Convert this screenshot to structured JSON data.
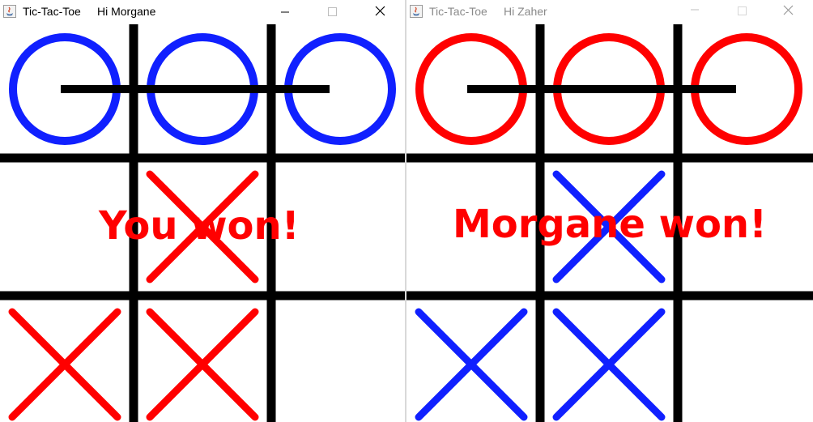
{
  "colors": {
    "grid": "#000000",
    "red": "#ff0000",
    "blue": "#1020ff"
  },
  "windows": [
    {
      "id": "left",
      "title_app": "Tic-Tac-Toe",
      "title_greeting": "Hi Morgane",
      "active": true,
      "message": "You won!",
      "cells": [
        {
          "mark": "O",
          "color": "blue"
        },
        {
          "mark": "O",
          "color": "blue"
        },
        {
          "mark": "O",
          "color": "blue"
        },
        null,
        {
          "mark": "X",
          "color": "red"
        },
        null,
        {
          "mark": "X",
          "color": "red"
        },
        {
          "mark": "X",
          "color": "red"
        },
        null
      ],
      "win_line": [
        0,
        2
      ]
    },
    {
      "id": "right",
      "title_app": "Tic-Tac-Toe",
      "title_greeting": "Hi Zaher",
      "active": false,
      "message": "Morgane won!",
      "cells": [
        {
          "mark": "O",
          "color": "red"
        },
        {
          "mark": "O",
          "color": "red"
        },
        {
          "mark": "O",
          "color": "red"
        },
        null,
        {
          "mark": "X",
          "color": "blue"
        },
        null,
        {
          "mark": "X",
          "color": "blue"
        },
        {
          "mark": "X",
          "color": "blue"
        },
        null
      ],
      "win_line": [
        0,
        2
      ]
    }
  ]
}
